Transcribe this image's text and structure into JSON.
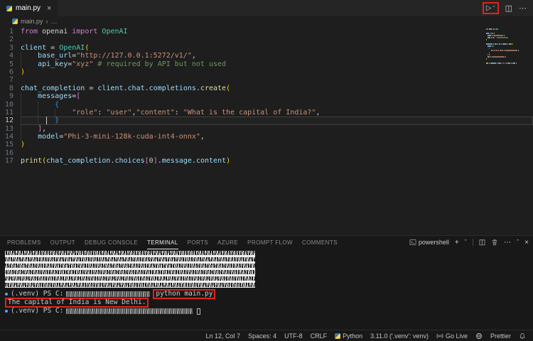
{
  "tab_bar": {
    "tab_title": "main.py",
    "close_glyph": "×",
    "run_glyph": "▷",
    "run_chevron_glyph": "ˇ",
    "split_glyph": "◫",
    "more_glyph": "⋯"
  },
  "breadcrumb": {
    "file": "main.py",
    "separator": "›",
    "more": "…"
  },
  "editor": {
    "cursor": {
      "line": 12,
      "col": 7
    },
    "token_colors": {
      "kw": "#C586C0",
      "pl": "#D4D4D4",
      "var": "#9CDCFE",
      "cls": "#4EC9B0",
      "str": "#CE9178",
      "com": "#6A9955",
      "fn": "#DCDCAA",
      "num": "#B5CEA8",
      "b1": "#FFD700",
      "b2": "#DA70D6",
      "b3": "#179FFF"
    },
    "lines": [
      {
        "n": 1,
        "indent": 0,
        "tokens": [
          [
            "from ",
            "kw"
          ],
          [
            "openai ",
            "pl"
          ],
          [
            "import ",
            "kw"
          ],
          [
            "OpenAI",
            "cls"
          ]
        ]
      },
      {
        "n": 2,
        "indent": 0,
        "tokens": []
      },
      {
        "n": 3,
        "indent": 0,
        "tokens": [
          [
            "client ",
            "var"
          ],
          [
            "= ",
            "pl"
          ],
          [
            "OpenAI",
            "cls"
          ],
          [
            "(",
            "b1"
          ]
        ]
      },
      {
        "n": 4,
        "indent": 1,
        "tokens": [
          [
            "base_url",
            "var"
          ],
          [
            "=",
            "pl"
          ],
          [
            "\"http://127.0.0.1:5272/v1/\"",
            "str"
          ],
          [
            ",",
            "pl"
          ]
        ]
      },
      {
        "n": 5,
        "indent": 1,
        "tokens": [
          [
            "api_key",
            "var"
          ],
          [
            "=",
            "pl"
          ],
          [
            "\"xyz\"",
            "str"
          ],
          [
            " ",
            "pl"
          ],
          [
            "# required by API but not used",
            "com"
          ]
        ]
      },
      {
        "n": 6,
        "indent": 0,
        "tokens": [
          [
            ")",
            "b1"
          ]
        ]
      },
      {
        "n": 7,
        "indent": 0,
        "tokens": []
      },
      {
        "n": 8,
        "indent": 0,
        "tokens": [
          [
            "chat_completion ",
            "var"
          ],
          [
            "= ",
            "pl"
          ],
          [
            "client",
            "var"
          ],
          [
            ".",
            "pl"
          ],
          [
            "chat",
            "var"
          ],
          [
            ".",
            "pl"
          ],
          [
            "completions",
            "var"
          ],
          [
            ".",
            "pl"
          ],
          [
            "create",
            "fn"
          ],
          [
            "(",
            "b1"
          ]
        ]
      },
      {
        "n": 9,
        "indent": 1,
        "tokens": [
          [
            "messages",
            "var"
          ],
          [
            "=",
            "pl"
          ],
          [
            "[",
            "b2"
          ]
        ]
      },
      {
        "n": 10,
        "indent": 2,
        "tokens": [
          [
            "{",
            "b3"
          ]
        ]
      },
      {
        "n": 11,
        "indent": 3,
        "tokens": [
          [
            "\"role\"",
            "str"
          ],
          [
            ": ",
            "pl"
          ],
          [
            "\"user\"",
            "str"
          ],
          [
            ",",
            "pl"
          ],
          [
            "\"content\"",
            "str"
          ],
          [
            ": ",
            "pl"
          ],
          [
            "\"What is the capital of India?\"",
            "str"
          ],
          [
            ",",
            "pl"
          ]
        ]
      },
      {
        "n": 12,
        "indent": 2,
        "tokens": [
          [
            "}",
            "b3"
          ]
        ],
        "current": true
      },
      {
        "n": 13,
        "indent": 1,
        "tokens": [
          [
            "]",
            "b2"
          ],
          [
            ",",
            "pl"
          ]
        ]
      },
      {
        "n": 14,
        "indent": 1,
        "tokens": [
          [
            "model",
            "var"
          ],
          [
            "=",
            "pl"
          ],
          [
            "\"Phi-3-mini-128k-cuda-int4-onnx\"",
            "str"
          ],
          [
            ",",
            "pl"
          ]
        ]
      },
      {
        "n": 15,
        "indent": 0,
        "tokens": [
          [
            ")",
            "b1"
          ]
        ]
      },
      {
        "n": 16,
        "indent": 0,
        "tokens": []
      },
      {
        "n": 17,
        "indent": 0,
        "tokens": [
          [
            "print",
            "fn"
          ],
          [
            "(",
            "b1"
          ],
          [
            "chat_completion",
            "var"
          ],
          [
            ".",
            "pl"
          ],
          [
            "choices",
            "var"
          ],
          [
            "[",
            "b2"
          ],
          [
            "0",
            "num"
          ],
          [
            "]",
            "b2"
          ],
          [
            ".",
            "pl"
          ],
          [
            "message",
            "var"
          ],
          [
            ".",
            "pl"
          ],
          [
            "content",
            "var"
          ],
          [
            ")",
            "b1"
          ]
        ]
      }
    ]
  },
  "panel": {
    "tabs": [
      {
        "label": "PROBLEMS"
      },
      {
        "label": "OUTPUT"
      },
      {
        "label": "DEBUG CONSOLE"
      },
      {
        "label": "TERMINAL",
        "active": true
      },
      {
        "label": "PORTS"
      },
      {
        "label": "AZURE"
      },
      {
        "label": "PROMPT FLOW"
      },
      {
        "label": "COMMENTS"
      }
    ],
    "shell_label": "powershell",
    "icons": {
      "new": "+",
      "dropdown": "ˇ",
      "split": "◫",
      "more": "⋯",
      "collapse": "ˆ",
      "close": "×"
    }
  },
  "terminal": {
    "lines": [
      {
        "marker": true,
        "parts": [
          {
            "text": "(.venv) PS C:"
          },
          {
            "redact_width": 118
          },
          {
            "text": "python main.py",
            "boxed": true
          }
        ]
      },
      {
        "parts": [
          {
            "text": "The capital of India is New Delhi.",
            "boxed": true
          }
        ]
      },
      {
        "marker": true,
        "parts": [
          {
            "text": "(.venv) PS C:"
          },
          {
            "redact_width": 178
          },
          {
            "cursor": true
          }
        ]
      }
    ]
  },
  "status_bar": {
    "cursor_position": "Ln 12, Col 7",
    "indentation": "Spaces: 4",
    "encoding": "UTF-8",
    "eol": "CRLF",
    "language": "Python",
    "interpreter": "3.11.0 ('.venv': venv)",
    "go_live": "Go Live",
    "formatter": "Prettier"
  }
}
